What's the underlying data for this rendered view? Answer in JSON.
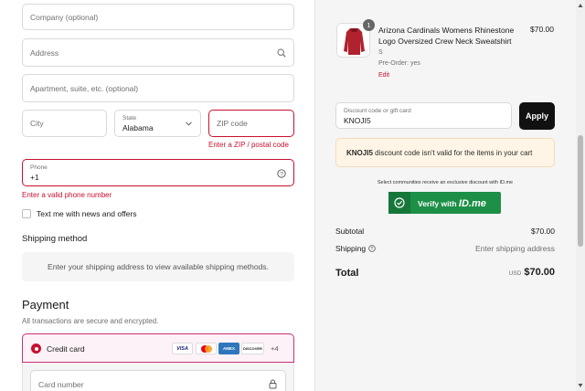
{
  "form": {
    "company_placeholder": "Company (optional)",
    "address_placeholder": "Address",
    "apartment_placeholder": "Apartment, suite, etc. (optional)",
    "city_placeholder": "City",
    "state_label": "State",
    "state_value": "Alabama",
    "zip_placeholder": "ZIP code",
    "zip_error": "Enter a ZIP / postal code",
    "phone_label": "Phone",
    "phone_value": "+1",
    "phone_error": "Enter a valid phone number",
    "news_checkbox_label": "Text me with news and offers"
  },
  "shipping": {
    "title": "Shipping method",
    "placeholder": "Enter your shipping address to view available shipping methods."
  },
  "payment": {
    "title": "Payment",
    "subtitle": "All transactions are secure and encrypted.",
    "card_option_label": "Credit card",
    "card_logos": [
      "VISA",
      "Mastercard",
      "AMEX",
      "DISCOVER"
    ],
    "more_logos": "+4",
    "card_number_placeholder": "Card number"
  },
  "order": {
    "quantity_badge": "1",
    "product_name": "Arizona Cardinals Womens Rhinestone Logo Oversized Crew Neck Sweatshirt",
    "variant": "S",
    "preorder": "Pre-Order: yes",
    "edit_label": "Edit",
    "price": "$70.00"
  },
  "discount": {
    "label": "Discount code or gift card",
    "value": "KNOJI5",
    "apply_label": "Apply",
    "notice_code": "KNOJI5",
    "notice_text": " discount code isn't valid for the items in your cart"
  },
  "idme": {
    "note": "Select communities receive an exclusive discount with ID.me",
    "button_label": "Verify with",
    "brand": "ID.me"
  },
  "summary": {
    "subtotal_label": "Subtotal",
    "subtotal_value": "$70.00",
    "shipping_label": "Shipping",
    "shipping_value": "Enter shipping address",
    "total_label": "Total",
    "currency": "USD",
    "total_value": "$70.00"
  },
  "colors": {
    "error": "#c8102e",
    "idme_green": "#1d8f47",
    "notice_bg": "#fff5e6"
  }
}
